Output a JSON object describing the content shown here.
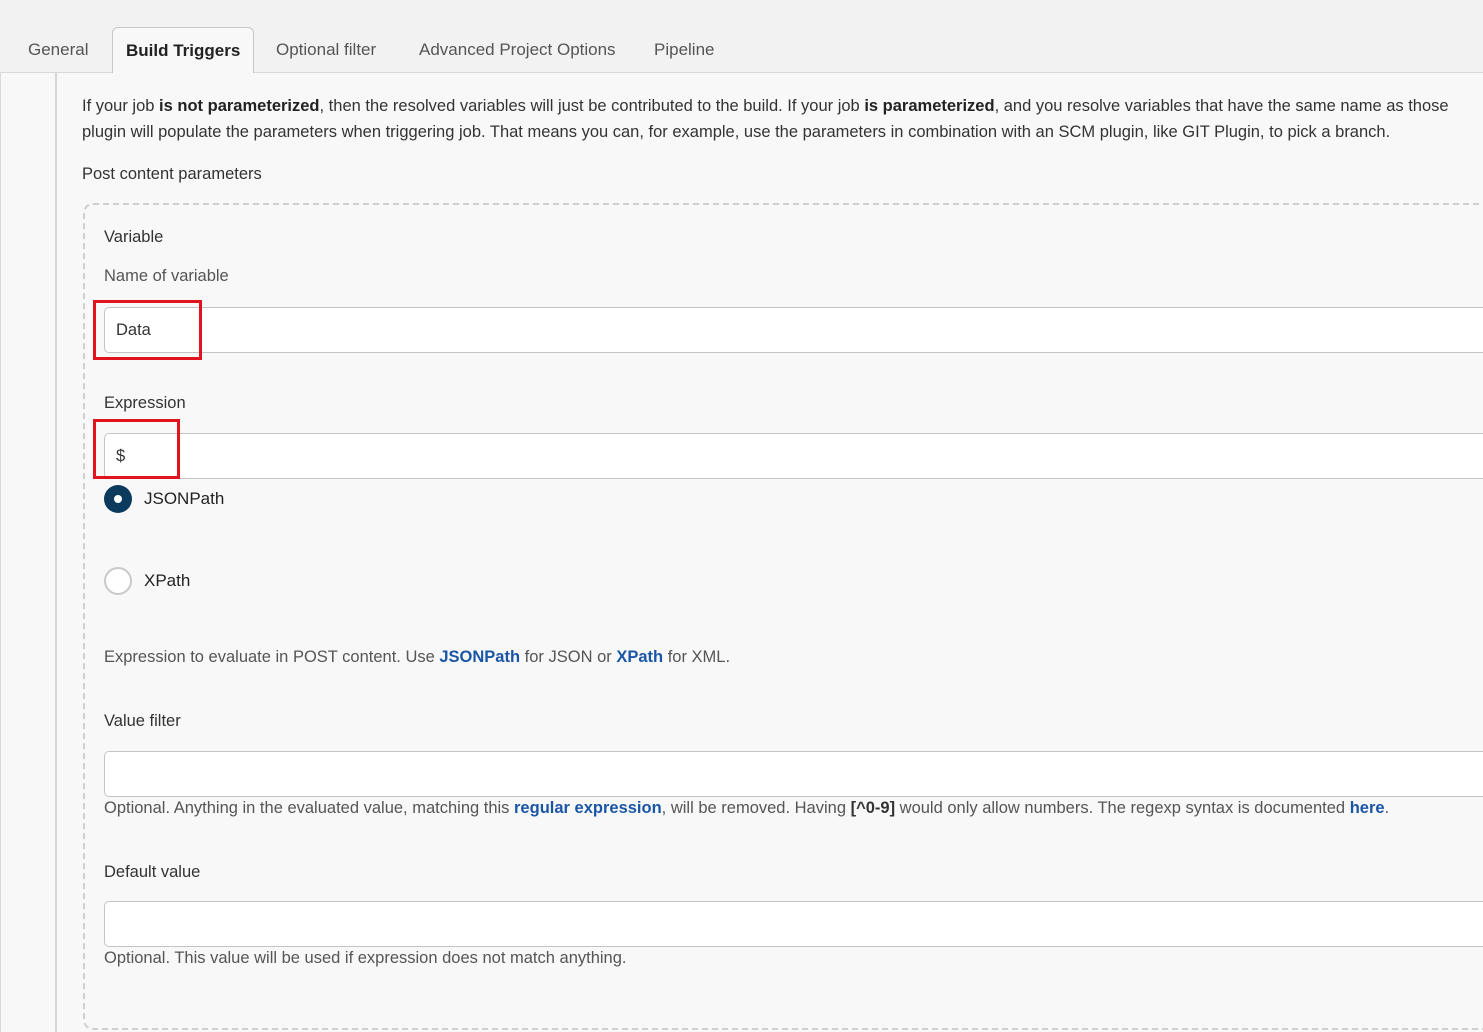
{
  "tabs": [
    {
      "label": "General",
      "active": false
    },
    {
      "label": "Build Triggers",
      "active": true
    },
    {
      "label": "Optional filter",
      "active": false
    },
    {
      "label": "Advanced Project Options",
      "active": false
    },
    {
      "label": "Pipeline",
      "active": false
    }
  ],
  "description": {
    "t1": "If your job ",
    "b1": "is not parameterized",
    "t2": ", then the resolved variables will just be contributed to the build. If your job ",
    "b2": "is parameterized",
    "t3": ", and you resolve variables that have the same name as those",
    "line2": "plugin will populate the parameters when triggering job. That means you can, for example, use the parameters in combination with an SCM plugin, like GIT Plugin, to pick a branch."
  },
  "post_content": {
    "section_title": "Post content parameters",
    "variable_label": "Variable",
    "variable_sublabel": "Name of variable",
    "variable_value": "Data",
    "expression_label": "Expression",
    "expression_value": "$",
    "radio_jsonpath": "JSONPath",
    "radio_xpath": "XPath",
    "selected": "JSONPath",
    "expr_help": {
      "t1": "Expression to evaluate in POST content. Use ",
      "link1": "JSONPath",
      "t2": " for JSON or ",
      "link2": "XPath",
      "t3": " for XML."
    },
    "value_filter_label": "Value filter",
    "value_filter_value": "",
    "value_filter_help": {
      "t1": "Optional. Anything in the evaluated value, matching this ",
      "link1": "regular expression",
      "t2": ", will be removed. Having ",
      "code": "[^0-9]",
      "t3": " would only allow numbers. The regexp syntax is documented ",
      "link2": "here",
      "t4": "."
    },
    "default_value_label": "Default value",
    "default_value_value": "",
    "default_value_help": "Optional. This value will be used if expression does not match anything."
  },
  "colors": {
    "highlight": "#e0141e",
    "link": "#1a56a6",
    "radio_checked": "#0b3a5c"
  }
}
